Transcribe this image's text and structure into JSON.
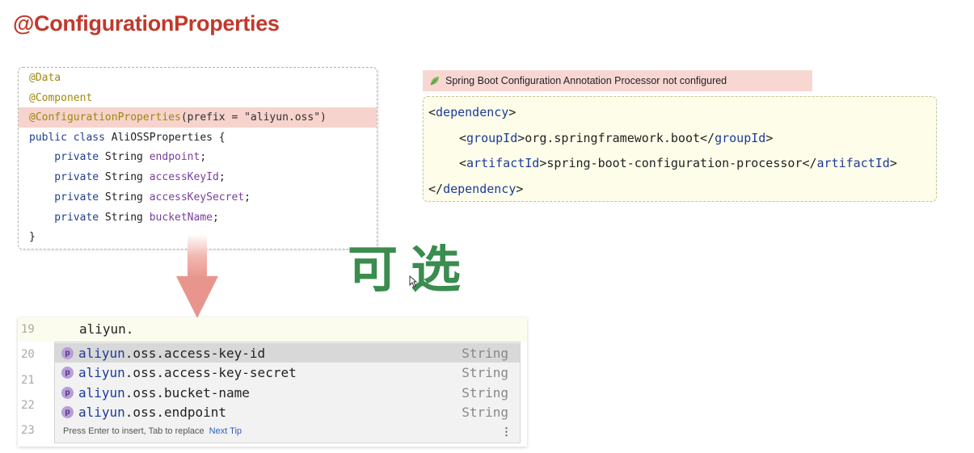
{
  "title": "@ConfigurationProperties",
  "code": {
    "lines": [
      {
        "a": "@Data"
      },
      {
        "a": "@Component"
      },
      {
        "a": "@ConfigurationProperties",
        "b": "(prefix = \"aliyun.oss\")"
      },
      {
        "k": "public class ",
        "p": "AliOSSProperties {"
      },
      {
        "k": "    private ",
        "p": "String ",
        "f": "endpoint",
        "e": ";"
      },
      {
        "k": "    private ",
        "p": "String ",
        "f": "accessKeyId",
        "e": ";"
      },
      {
        "k": "    private ",
        "p": "String ",
        "f": "accessKeySecret",
        "e": ";"
      },
      {
        "k": "    private ",
        "p": "String ",
        "f": "bucketName",
        "e": ";"
      },
      {
        "p": "}"
      }
    ]
  },
  "warning": {
    "text": "Spring Boot Configuration Annotation Processor not configured",
    "icon": "leaf-icon"
  },
  "dependency": {
    "open_lt": "<",
    "dep_tag": "dependency",
    "gt": ">",
    "group_tag": "groupId",
    "group_value": "org.springframework.boot",
    "artifact_tag": "artifactId",
    "artifact_value": "spring-boot-configuration-processor",
    "close_lt": "</"
  },
  "optional_label": "可选",
  "editor": {
    "line_numbers": [
      "19",
      "20",
      "21",
      "22",
      "23"
    ],
    "current_text": "aliyun.",
    "items": [
      {
        "prefix": "aliyun",
        "rest": ".oss.access-key-id",
        "type": "String",
        "badge": "p"
      },
      {
        "prefix": "aliyun",
        "rest": ".oss.access-key-secret",
        "type": "String",
        "badge": "p"
      },
      {
        "prefix": "aliyun",
        "rest": ".oss.bucket-name",
        "type": "String",
        "badge": "p"
      },
      {
        "prefix": "aliyun",
        "rest": ".oss.endpoint",
        "type": "String",
        "badge": "p"
      }
    ],
    "footer_text": "Press Enter to insert, Tab to replace",
    "next_tip": "Next Tip",
    "more_icon": "⋮"
  },
  "colors": {
    "title": "#c0392b",
    "accent_green": "#3a8c4f",
    "highlight": "#f6d3cc",
    "arrow": "#e8a09a"
  }
}
